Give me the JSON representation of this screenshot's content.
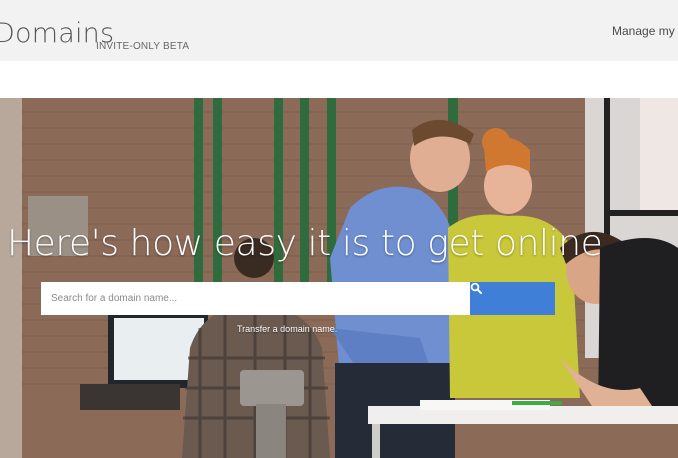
{
  "header": {
    "brand": "Domains",
    "badge": "INVITE-ONLY BETA",
    "manage_link": "Manage my d"
  },
  "hero": {
    "headline": "Here's how easy it is to get online",
    "search_placeholder": "Search for a domain name...",
    "search_button_icon": "search-icon",
    "transfer_link": "Transfer a domain name."
  },
  "colors": {
    "header_bg": "#f2f2f2",
    "search_button": "#3f7fd8"
  }
}
